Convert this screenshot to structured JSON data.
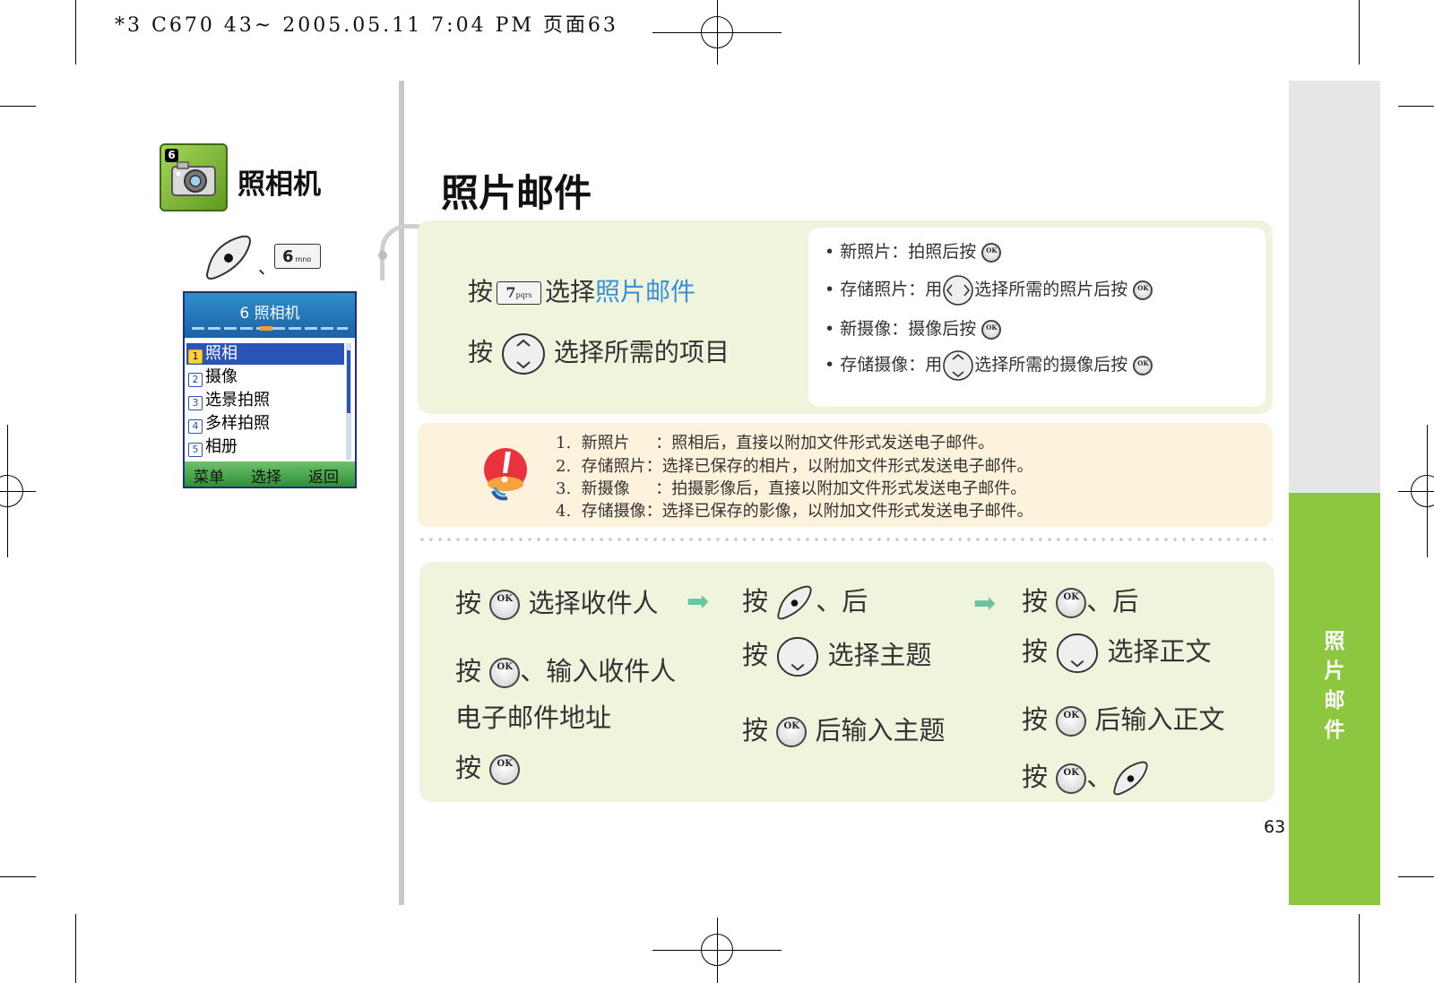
{
  "print_header": "*3 C670 43~ 2005.05.11 7:04 PM 页面63",
  "side_tab": [
    "照",
    "片",
    "邮",
    "件"
  ],
  "section": {
    "number": "6",
    "title": "照相机",
    "shortcut_separator": "、",
    "key_6": "6",
    "key_6_letters": "mno"
  },
  "phone": {
    "title": "6 照相机",
    "menu": [
      {
        "num": "1",
        "label": "照相"
      },
      {
        "num": "2",
        "label": "摄像"
      },
      {
        "num": "3",
        "label": "选景拍照"
      },
      {
        "num": "4",
        "label": "多样拍照"
      },
      {
        "num": "5",
        "label": "相册"
      }
    ],
    "softkeys": [
      "菜单",
      "选择",
      "返回"
    ]
  },
  "page_title": "照片邮件",
  "step1": {
    "line1_press": "按",
    "key_7": "7",
    "key_7_letters": "pqrs",
    "line1_text": "选择",
    "line1_highlight": "照片邮件",
    "line2_press": "按",
    "line2_text": "选择所需的项目"
  },
  "options": [
    {
      "label": "新照片：拍照后按",
      "after": ""
    },
    {
      "label": "存储照片：用",
      "after": "选择所需的照片后按"
    },
    {
      "label": "新摄像：摄像后按",
      "after": ""
    },
    {
      "label": "存储摄像：用",
      "after": "选择所需的摄像后按"
    }
  ],
  "notes": [
    "1.  新照片     ：照相后，直接以附加文件形式发送电子邮件。",
    "2.  存储照片：选择已保存的相片，以附加文件形式发送电子邮件。",
    "3.  新摄像     ：拍摄影像后，直接以附加文件形式发送电子邮件。",
    "4.  存储摄像：选择已保存的影像，以附加文件形式发送电子邮件。"
  ],
  "ok_label": "OK",
  "steps": {
    "col1": {
      "l1_press": "按",
      "l1_text": "选择收件人",
      "l2_press": "按",
      "l2_text": "、输入收件人",
      "l3_text": "电子邮件地址",
      "l4_press": "按"
    },
    "col2": {
      "l1_press": "按",
      "l1_text": "、后",
      "l2_press": "按",
      "l2_text": "选择主题",
      "l3_press": "按",
      "l3_text": "后输入主题"
    },
    "col3": {
      "l1_press": "按",
      "l1_text": "、后",
      "l2_press": "按",
      "l2_text": "选择正文",
      "l3_press": "按",
      "l3_text": "后输入正文",
      "l4_press": "按",
      "l4_text": "、"
    }
  },
  "page_number": "63",
  "colors": {
    "accent_green": "#8dc63f",
    "highlight_blue": "#3b8fd6",
    "box_green": "#eef5dc",
    "box_cream": "#fdf2dc"
  },
  "icons": [
    "camera-icon",
    "softkey-icon",
    "ok-key-icon",
    "nav-key-icon",
    "warning-icon",
    "arrow-right-icon"
  ]
}
